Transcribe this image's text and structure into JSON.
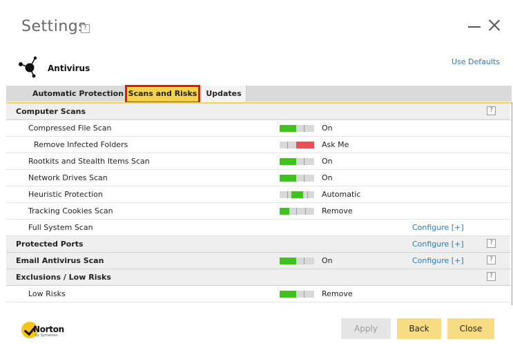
{
  "window": {
    "title": "Settings",
    "help_glyph": "?"
  },
  "section": {
    "name": "Antivirus",
    "icon": "antivirus-icon",
    "use_defaults": "Use Defaults"
  },
  "tabs": [
    {
      "label": "Automatic Protection",
      "selected": false
    },
    {
      "label": "Scans and Risks",
      "selected": true
    },
    {
      "label": "Updates",
      "selected": false
    }
  ],
  "rows": {
    "computer_scans": {
      "label": "Computer Scans",
      "help": "?"
    },
    "compressed": {
      "label": "Compressed File Scan",
      "value": "On"
    },
    "remove_infected": {
      "label": "Remove Infected Folders",
      "value": "Ask Me"
    },
    "rootkits": {
      "label": "Rootkits and Stealth Items Scan",
      "value": "On"
    },
    "network": {
      "label": "Network Drives Scan",
      "value": "On"
    },
    "heuristic": {
      "label": "Heuristic Protection",
      "value": "Automatic"
    },
    "tracking": {
      "label": "Tracking Cookies Scan",
      "value": "Remove"
    },
    "full_system": {
      "label": "Full System Scan",
      "link": "Configure [+]"
    },
    "protected_ports": {
      "label": "Protected Ports",
      "link": "Configure [+]",
      "help": "?"
    },
    "email": {
      "label": "Email Antivirus Scan",
      "value": "On",
      "link": "Configure [+]",
      "help": "?"
    },
    "exclusions": {
      "label": "Exclusions / Low Risks",
      "help": "?"
    },
    "low_risks": {
      "label": "Low Risks",
      "value": "Remove"
    }
  },
  "footer": {
    "brand": "Norton",
    "brand_sub": "by Symantec",
    "apply": "Apply",
    "back": "Back",
    "close": "Close"
  },
  "colors": {
    "on": "#3fc21d",
    "ask": "#e8515a",
    "accent": "#f6d14b",
    "link": "#2a7ab0"
  }
}
